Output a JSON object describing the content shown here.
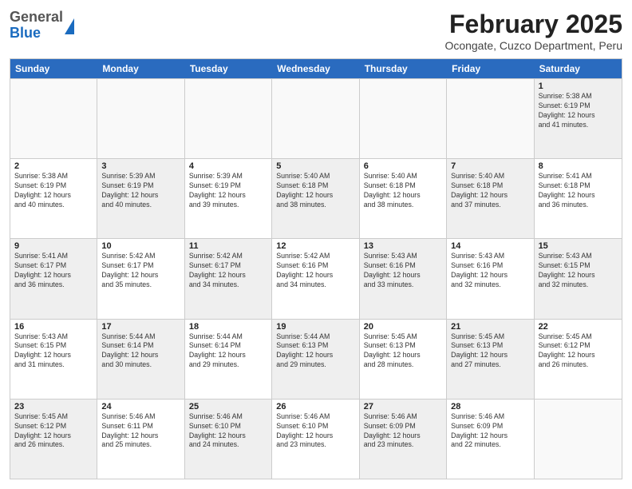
{
  "header": {
    "logo": {
      "general": "General",
      "blue": "Blue"
    },
    "title": "February 2025",
    "subtitle": "Ocongate, Cuzco Department, Peru"
  },
  "days": [
    "Sunday",
    "Monday",
    "Tuesday",
    "Wednesday",
    "Thursday",
    "Friday",
    "Saturday"
  ],
  "weeks": [
    [
      {
        "day": "",
        "info": "",
        "shaded": false
      },
      {
        "day": "",
        "info": "",
        "shaded": false
      },
      {
        "day": "",
        "info": "",
        "shaded": false
      },
      {
        "day": "",
        "info": "",
        "shaded": false
      },
      {
        "day": "",
        "info": "",
        "shaded": false
      },
      {
        "day": "",
        "info": "",
        "shaded": false
      },
      {
        "day": "1",
        "info": "Sunrise: 5:38 AM\nSunset: 6:19 PM\nDaylight: 12 hours\nand 41 minutes.",
        "shaded": true
      }
    ],
    [
      {
        "day": "2",
        "info": "Sunrise: 5:38 AM\nSunset: 6:19 PM\nDaylight: 12 hours\nand 40 minutes.",
        "shaded": false
      },
      {
        "day": "3",
        "info": "Sunrise: 5:39 AM\nSunset: 6:19 PM\nDaylight: 12 hours\nand 40 minutes.",
        "shaded": true
      },
      {
        "day": "4",
        "info": "Sunrise: 5:39 AM\nSunset: 6:19 PM\nDaylight: 12 hours\nand 39 minutes.",
        "shaded": false
      },
      {
        "day": "5",
        "info": "Sunrise: 5:40 AM\nSunset: 6:18 PM\nDaylight: 12 hours\nand 38 minutes.",
        "shaded": true
      },
      {
        "day": "6",
        "info": "Sunrise: 5:40 AM\nSunset: 6:18 PM\nDaylight: 12 hours\nand 38 minutes.",
        "shaded": false
      },
      {
        "day": "7",
        "info": "Sunrise: 5:40 AM\nSunset: 6:18 PM\nDaylight: 12 hours\nand 37 minutes.",
        "shaded": true
      },
      {
        "day": "8",
        "info": "Sunrise: 5:41 AM\nSunset: 6:18 PM\nDaylight: 12 hours\nand 36 minutes.",
        "shaded": false
      }
    ],
    [
      {
        "day": "9",
        "info": "Sunrise: 5:41 AM\nSunset: 6:17 PM\nDaylight: 12 hours\nand 36 minutes.",
        "shaded": true
      },
      {
        "day": "10",
        "info": "Sunrise: 5:42 AM\nSunset: 6:17 PM\nDaylight: 12 hours\nand 35 minutes.",
        "shaded": false
      },
      {
        "day": "11",
        "info": "Sunrise: 5:42 AM\nSunset: 6:17 PM\nDaylight: 12 hours\nand 34 minutes.",
        "shaded": true
      },
      {
        "day": "12",
        "info": "Sunrise: 5:42 AM\nSunset: 6:16 PM\nDaylight: 12 hours\nand 34 minutes.",
        "shaded": false
      },
      {
        "day": "13",
        "info": "Sunrise: 5:43 AM\nSunset: 6:16 PM\nDaylight: 12 hours\nand 33 minutes.",
        "shaded": true
      },
      {
        "day": "14",
        "info": "Sunrise: 5:43 AM\nSunset: 6:16 PM\nDaylight: 12 hours\nand 32 minutes.",
        "shaded": false
      },
      {
        "day": "15",
        "info": "Sunrise: 5:43 AM\nSunset: 6:15 PM\nDaylight: 12 hours\nand 32 minutes.",
        "shaded": true
      }
    ],
    [
      {
        "day": "16",
        "info": "Sunrise: 5:43 AM\nSunset: 6:15 PM\nDaylight: 12 hours\nand 31 minutes.",
        "shaded": false
      },
      {
        "day": "17",
        "info": "Sunrise: 5:44 AM\nSunset: 6:14 PM\nDaylight: 12 hours\nand 30 minutes.",
        "shaded": true
      },
      {
        "day": "18",
        "info": "Sunrise: 5:44 AM\nSunset: 6:14 PM\nDaylight: 12 hours\nand 29 minutes.",
        "shaded": false
      },
      {
        "day": "19",
        "info": "Sunrise: 5:44 AM\nSunset: 6:13 PM\nDaylight: 12 hours\nand 29 minutes.",
        "shaded": true
      },
      {
        "day": "20",
        "info": "Sunrise: 5:45 AM\nSunset: 6:13 PM\nDaylight: 12 hours\nand 28 minutes.",
        "shaded": false
      },
      {
        "day": "21",
        "info": "Sunrise: 5:45 AM\nSunset: 6:13 PM\nDaylight: 12 hours\nand 27 minutes.",
        "shaded": true
      },
      {
        "day": "22",
        "info": "Sunrise: 5:45 AM\nSunset: 6:12 PM\nDaylight: 12 hours\nand 26 minutes.",
        "shaded": false
      }
    ],
    [
      {
        "day": "23",
        "info": "Sunrise: 5:45 AM\nSunset: 6:12 PM\nDaylight: 12 hours\nand 26 minutes.",
        "shaded": true
      },
      {
        "day": "24",
        "info": "Sunrise: 5:46 AM\nSunset: 6:11 PM\nDaylight: 12 hours\nand 25 minutes.",
        "shaded": false
      },
      {
        "day": "25",
        "info": "Sunrise: 5:46 AM\nSunset: 6:10 PM\nDaylight: 12 hours\nand 24 minutes.",
        "shaded": true
      },
      {
        "day": "26",
        "info": "Sunrise: 5:46 AM\nSunset: 6:10 PM\nDaylight: 12 hours\nand 23 minutes.",
        "shaded": false
      },
      {
        "day": "27",
        "info": "Sunrise: 5:46 AM\nSunset: 6:09 PM\nDaylight: 12 hours\nand 23 minutes.",
        "shaded": true
      },
      {
        "day": "28",
        "info": "Sunrise: 5:46 AM\nSunset: 6:09 PM\nDaylight: 12 hours\nand 22 minutes.",
        "shaded": false
      },
      {
        "day": "",
        "info": "",
        "shaded": false
      }
    ]
  ]
}
